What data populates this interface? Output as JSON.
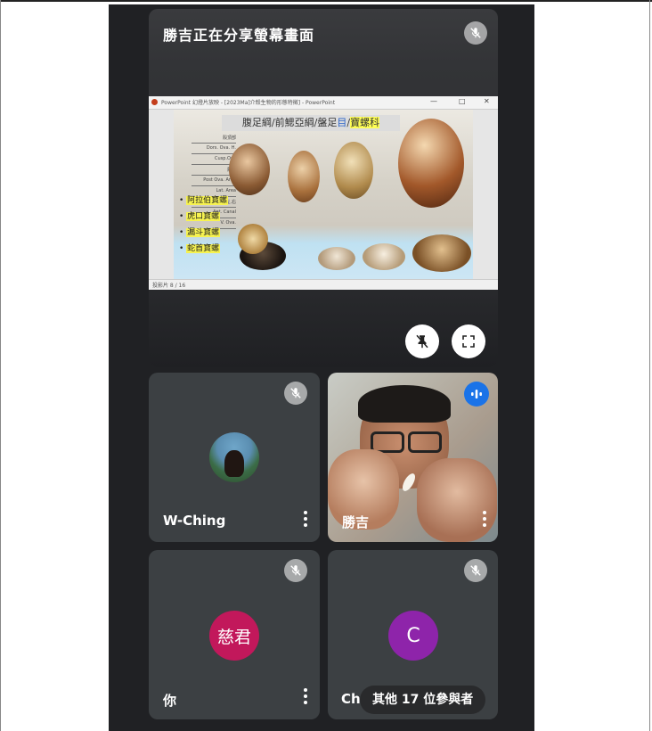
{
  "share": {
    "title": "勝吉正在分享螢幕畫面",
    "window_title": "PowerPoint 幻燈片放映 - [2023Ma]介殼生物的形態特徵] - PowerPoint",
    "window_controls": [
      "—",
      "□",
      "✕"
    ],
    "slide_title_parts": [
      "腹足綱/前鰓亞綱/盤足",
      "目",
      "/",
      "寶螺科"
    ],
    "slide_labels": [
      "殼頂部",
      "Dors. Ova. H.",
      "Cusp.Ova",
      "殼背",
      "Post Ova. Area",
      "Lat. Area",
      "左,右",
      "Ant. Canal",
      "V. Ova."
    ],
    "bullets": [
      "阿拉伯寶螺",
      "虎口寶螺",
      "漏斗寶螺",
      "蛇首寶螺"
    ],
    "statusbar": "投影片 8 / 16"
  },
  "participants": [
    {
      "name": "W-Ching",
      "avatar_type": "photo"
    },
    {
      "name": "勝吉",
      "avatar_type": "video"
    },
    {
      "name": "你",
      "avatar_initial": "慈君",
      "avatar_color": "#c2185b"
    },
    {
      "name": "Ch",
      "avatar_initial": "C",
      "avatar_color": "#8e24aa"
    }
  ],
  "more_participants": "其他 17 位參與者",
  "colors": {
    "background": "#202124",
    "tile": "#3c4043",
    "speaking": "#1a73e8"
  }
}
